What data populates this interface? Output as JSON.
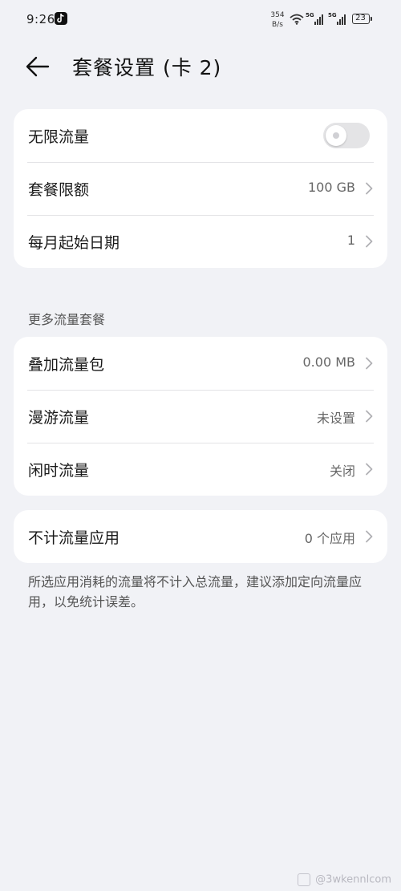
{
  "status_bar": {
    "time": "9:26",
    "net_speed_value": "354",
    "net_speed_unit": "B/s",
    "sim1_label": "5G",
    "sim2_label": "5G",
    "battery": "23"
  },
  "header": {
    "title": "套餐设置 (卡 2)"
  },
  "card1": {
    "unlimited_label": "无限流量",
    "unlimited_on": false,
    "plan_limit_label": "套餐限额",
    "plan_limit_value": "100 GB",
    "start_date_label": "每月起始日期",
    "start_date_value": "1"
  },
  "more_plans": {
    "section_title": "更多流量套餐",
    "addon_label": "叠加流量包",
    "addon_value": "0.00 MB",
    "roaming_label": "漫游流量",
    "roaming_value": "未设置",
    "idle_label": "闲时流量",
    "idle_value": "关闭"
  },
  "unmetered": {
    "label": "不计流量应用",
    "value": "0 个应用",
    "note": "所选应用消耗的流量将不计入总流量，建议添加定向流量应用，以免统计误差。"
  },
  "watermark": "@3wkennlcom"
}
